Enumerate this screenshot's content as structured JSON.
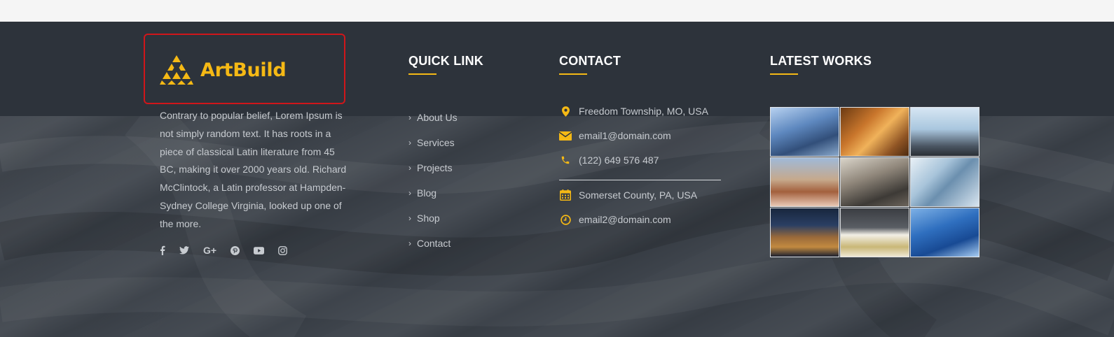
{
  "brand": {
    "name": "ArtBuild",
    "accent": "#f5b915"
  },
  "about": {
    "text": "Contrary to popular belief, Lorem Ipsum is not simply random text. It has roots in a piece of classical Latin literature from 45 BC, making it over 2000 years old. Richard McClintock, a Latin professor at Hampden-Sydney College Virginia, looked up one of the more."
  },
  "social": {
    "facebook": "f",
    "twitter": "twitter-icon",
    "googleplus": "G+",
    "pinterest": "pinterest-icon",
    "youtube": "youtube-icon",
    "instagram": "instagram-icon"
  },
  "quick_links": {
    "title": "QUICK LINK",
    "items": [
      "About Us",
      "Services",
      "Projects",
      "Blog",
      "Shop",
      "Contact"
    ]
  },
  "contact": {
    "title": "CONTACT",
    "address1": "Freedom Township, MO, USA",
    "email1": "email1@domain.com",
    "phone": "(122) 649 576 487",
    "address2": "Somerset County, PA, USA",
    "email2": "email2@domain.com"
  },
  "latest_works": {
    "title": "LATEST WORKS",
    "images": [
      "work-image-1",
      "work-image-2",
      "work-image-3",
      "work-image-4",
      "work-image-5",
      "work-image-6",
      "work-image-7",
      "work-image-8",
      "work-image-9"
    ]
  }
}
